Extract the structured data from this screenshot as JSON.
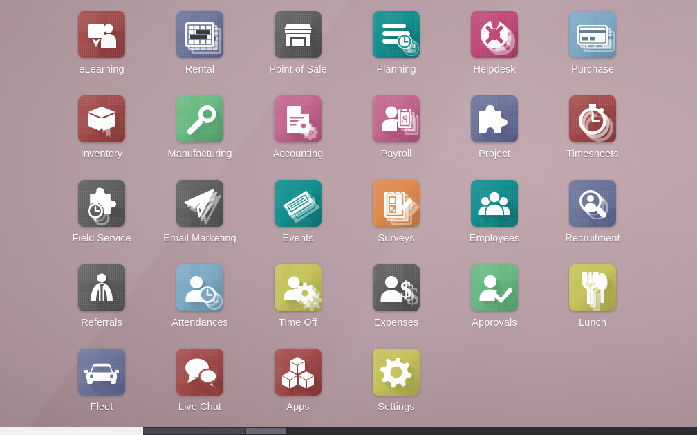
{
  "desktop": {
    "background_color": "#b59ba3",
    "bottom_bar_color": "#2e2b33"
  },
  "apps": [
    {
      "label": "eLearning",
      "icon": "elearning-icon",
      "color": "#a14a4a",
      "shadow": "#8a3b3b"
    },
    {
      "label": "Rental",
      "icon": "rental-icon",
      "color": "#6b7399",
      "shadow": "#59608a"
    },
    {
      "label": "Point of Sale",
      "icon": "point-of-sale-icon",
      "color": "#5f5f5f",
      "shadow": "#4e4e4e"
    },
    {
      "label": "Planning",
      "icon": "planning-icon",
      "color": "#128f8f",
      "shadow": "#0d7676"
    },
    {
      "label": "Helpdesk",
      "icon": "helpdesk-icon",
      "color": "#c04878",
      "shadow": "#a43a66"
    },
    {
      "label": "Purchase",
      "icon": "purchase-icon",
      "color": "#7aa8c4",
      "shadow": "#6492ae"
    },
    {
      "label": "Inventory",
      "icon": "inventory-icon",
      "color": "#a14a4a",
      "shadow": "#8a3b3b"
    },
    {
      "label": "Manufacturing",
      "icon": "manufacturing-icon",
      "color": "#68b981",
      "shadow": "#54a26c"
    },
    {
      "label": "Accounting",
      "icon": "accounting-icon",
      "color": "#c2658e",
      "shadow": "#a9537a"
    },
    {
      "label": "Payroll",
      "icon": "payroll-icon",
      "color": "#c2658e",
      "shadow": "#a9537a"
    },
    {
      "label": "Project",
      "icon": "project-icon",
      "color": "#6b7399",
      "shadow": "#59608a"
    },
    {
      "label": "Timesheets",
      "icon": "timesheets-icon",
      "color": "#a14a4a",
      "shadow": "#8a3b3b"
    },
    {
      "label": "Field Service",
      "icon": "field-service-icon",
      "color": "#5f5f5f",
      "shadow": "#4e4e4e"
    },
    {
      "label": "Email Marketing",
      "icon": "email-marketing-icon",
      "color": "#5f5f5f",
      "shadow": "#4e4e4e"
    },
    {
      "label": "Events",
      "icon": "events-icon",
      "color": "#128f8f",
      "shadow": "#0d7676"
    },
    {
      "label": "Surveys",
      "icon": "surveys-icon",
      "color": "#de8a4c",
      "shadow": "#c2743c"
    },
    {
      "label": "Employees",
      "icon": "employees-icon",
      "color": "#128f8f",
      "shadow": "#0d7676"
    },
    {
      "label": "Recruitment",
      "icon": "recruitment-icon",
      "color": "#6b7399",
      "shadow": "#59608a"
    },
    {
      "label": "Referrals",
      "icon": "referrals-icon",
      "color": "#5f5f5f",
      "shadow": "#4e4e4e"
    },
    {
      "label": "Attendances",
      "icon": "attendances-icon",
      "color": "#7aa8c4",
      "shadow": "#6492ae"
    },
    {
      "label": "Time Off",
      "icon": "time-off-icon",
      "color": "#c4c258",
      "shadow": "#a9a748"
    },
    {
      "label": "Expenses",
      "icon": "expenses-icon",
      "color": "#5f5f5f",
      "shadow": "#4e4e4e"
    },
    {
      "label": "Approvals",
      "icon": "approvals-icon",
      "color": "#68b981",
      "shadow": "#54a26c"
    },
    {
      "label": "Lunch",
      "icon": "lunch-icon",
      "color": "#c4c258",
      "shadow": "#a9a748"
    },
    {
      "label": "Fleet",
      "icon": "fleet-icon",
      "color": "#6b7399",
      "shadow": "#59608a"
    },
    {
      "label": "Live Chat",
      "icon": "live-chat-icon",
      "color": "#a14a4a",
      "shadow": "#8a3b3b"
    },
    {
      "label": "Apps",
      "icon": "apps-icon",
      "color": "#a14a4a",
      "shadow": "#8a3b3b"
    },
    {
      "label": "Settings",
      "icon": "settings-icon",
      "color": "#c4c258",
      "shadow": "#a9a748"
    }
  ]
}
